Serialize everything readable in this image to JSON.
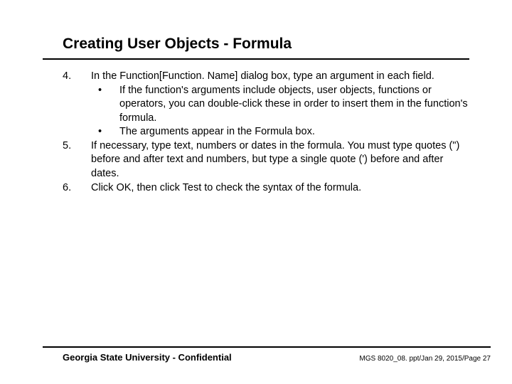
{
  "title": "Creating User Objects - Formula",
  "steps": [
    {
      "num": "4.",
      "text": "In the Function[Function. Name] dialog box, type an argument in each field.",
      "subs": [
        "If the function's arguments include objects, user objects, functions or operators, you can double-click these in order to insert them in the function's formula.",
        "The arguments appear in the Formula box."
      ]
    },
    {
      "num": "5.",
      "text": "If necessary, type text, numbers or dates in the formula.  You must type quotes (\") before and after text and numbers, but type a single quote (') before and after dates.",
      "subs": []
    },
    {
      "num": "6.",
      "text": "Click OK, then click Test to check the syntax of the formula.",
      "subs": []
    }
  ],
  "bullet_char": "•",
  "footer": {
    "left": "Georgia State University - Confidential",
    "right": "MGS 8020_08. ppt/Jan 29, 2015/Page 27"
  }
}
